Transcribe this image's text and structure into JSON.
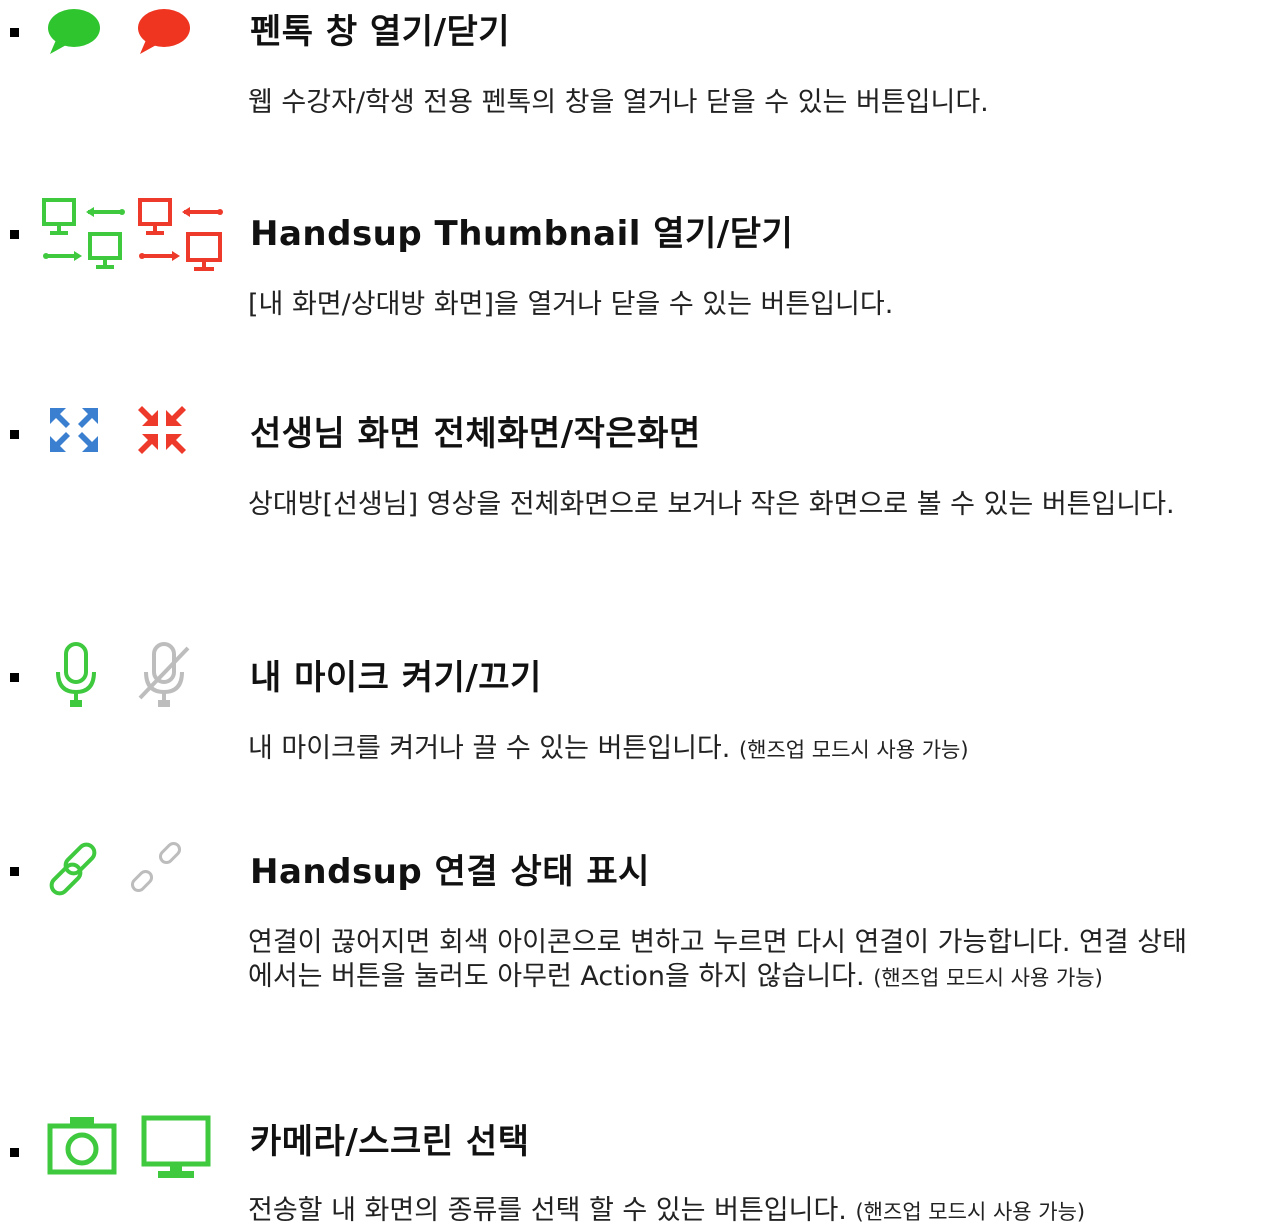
{
  "items": [
    {
      "title": "펜톡 창 열기/닫기",
      "desc": "웹 수강자/학생 전용 펜톡의 창을 열거나 닫을 수 있는 버튼입니다.",
      "desc_note": "",
      "icons": [
        "chat-bubble-green-icon",
        "chat-bubble-red-icon"
      ]
    },
    {
      "title": "Handsup Thumbnail 열기/닫기",
      "desc": "[내 화면/상대방 화면]을 열거나 닫을 수 있는 버튼입니다.",
      "desc_note": "",
      "icons": [
        "thumbnail-swap-green-icon",
        "thumbnail-swap-red-icon"
      ]
    },
    {
      "title": "선생님 화면 전체화면/작은화면",
      "desc": "상대방[선생님] 영상을 전체화면으로 보거나 작은 화면으로 볼 수 있는 버튼입니다.",
      "desc_note": "",
      "icons": [
        "expand-blue-icon",
        "shrink-red-icon"
      ]
    },
    {
      "title": "내 마이크 켜기/끄기",
      "desc": "내 마이크를 켜거나 끌 수 있는 버튼입니다.",
      "desc_note": "(핸즈업 모드시 사용 가능)",
      "icons": [
        "microphone-green-icon",
        "microphone-off-gray-icon"
      ]
    },
    {
      "title": "Handsup 연결 상태 표시",
      "desc": "연결이 끊어지면 회색 아이콘으로 변하고 누르면 다시 연결이 가능합니다. 연결 상태에서는 버튼을 눌러도 아무런 Action을 하지 않습니다.",
      "desc_note": "(핸즈업 모드시 사용 가능)",
      "icons": [
        "link-green-icon",
        "link-broken-gray-icon"
      ]
    },
    {
      "title": "카메라/스크린 선택",
      "desc": "전송할 내 화면의 종류를 선택 할 수 있는 버튼입니다.",
      "desc_note": "(핸즈업 모드시 사용 가능)",
      "icons": [
        "camera-green-icon",
        "monitor-green-icon"
      ]
    }
  ],
  "colors": {
    "green": "#3ec93e",
    "red": "#ee3a2a",
    "blue": "#3a7fd0",
    "gray": "#b9b9b9"
  }
}
